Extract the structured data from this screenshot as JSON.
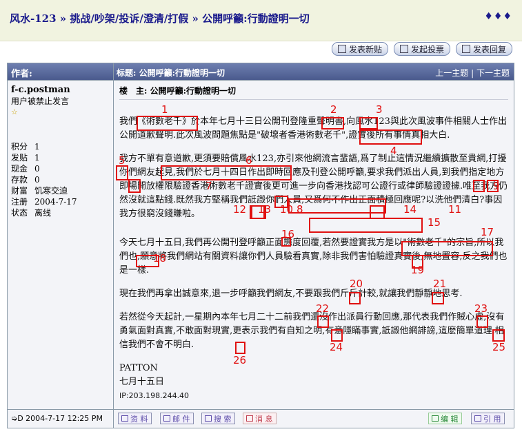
{
  "breadcrumb": {
    "forum": "风水-123",
    "board": "挑战/吵架/投诉/澄清/打假",
    "thread": "公開呼籲:行動證明一切",
    "sep": "»",
    "dots": "♦♦♦"
  },
  "actions": {
    "new_post": "发表新贴",
    "new_poll": "发起投票",
    "reply": "发表回复"
  },
  "table_header": {
    "author": "作者:",
    "title": "标题: 公開呼籲:行動證明一切",
    "prev": "上一主题",
    "sep": "|",
    "next": "下一主题"
  },
  "user": {
    "name": "f-c.postman",
    "status": "用户被禁止发言",
    "star": "☆",
    "stats": [
      {
        "k": "积分",
        "v": "1"
      },
      {
        "k": "发贴",
        "v": "1"
      },
      {
        "k": "现金",
        "v": "0"
      },
      {
        "k": "存款",
        "v": "0"
      },
      {
        "k": "财富",
        "v": "饥寒交迫"
      },
      {
        "k": "注册",
        "v": "2004-7-17"
      },
      {
        "k": "状态",
        "v": "离线"
      }
    ]
  },
  "post": {
    "heading": "楼　主: 公開呼籲:行動證明一切",
    "paragraphs": [
      "我們《術數老千》於本年七月十三日公開刊登隆重聲明書,向風水123與此次風波事件相關人士作出公開道歉聲明.此次風波問題焦點是\"破壞者香港術數老千\",證實後所有事情真相大白.",
      "我方不單有意道歉,更須要賠償風水123,亦引來他網流言蜚語,爲了制止這情況繼續擴散至貴網,打擾你們網友起見,我們於七月十四日作出即時回應及刊登公開呼籲,要求我們派出人員,到我們指定地方即場開放權限驗證香港術數老千證實後更可進一步向香港找認可公證行或律師驗證證據.唯至我方仍然沒就這點錢.既然我方堅稱我們詆譭你們人員,又爲何不作出正面積極回應呢?以洗他們清白?事因我方很窮沒錢賺啦。",
      "今天七月十五日,我們再公開刊登呼籲正面態度回覆,若然要證實我方是以\"術數老千\"的宗旨,所以我們也,願意將我們網站有關資料讓你們人員驗看真實,除非我們害怕驗證真實後,無地置容,反之我們也是一樣.",
      "現在我們再拿出誠意來,退一步呼籲我們網友,不要跟我們斤斤計較,就讓我們靜靜地思考.",
      "若然從今天起計,一星期內本年七月二十二前我們還沒作出派員行動回應,那代表我們作賊心虛,沒有勇氣面對真實,不敢面對現實,更表示我們有自知之明,有意隱瞞事實,詆譭他網誹謗,這麽簡單道理,相信我們不會不明白."
    ],
    "signature": "PATTON",
    "date_line": "七月十五日",
    "ip": "IP:203.198.244.40"
  },
  "annotations": [
    "1",
    "2",
    "3",
    "4",
    "5",
    "6",
    "7",
    "8",
    "9",
    "10",
    "11",
    "12",
    "13",
    "14",
    "15",
    "16",
    "17",
    "18",
    "19",
    "20",
    "21",
    "22",
    "23",
    "24",
    "25",
    "26"
  ],
  "footer": {
    "date": "➭D 2004-7-17 12:25 PM",
    "profile": "资 料",
    "email": "邮 件",
    "search": "搜 索",
    "message": "消 息",
    "edit": "编 辑",
    "quote": "引 用"
  },
  "colors": {
    "annotation": "#e01010",
    "header_bg": "#4a5a8d",
    "link": "#1a1a8c"
  }
}
